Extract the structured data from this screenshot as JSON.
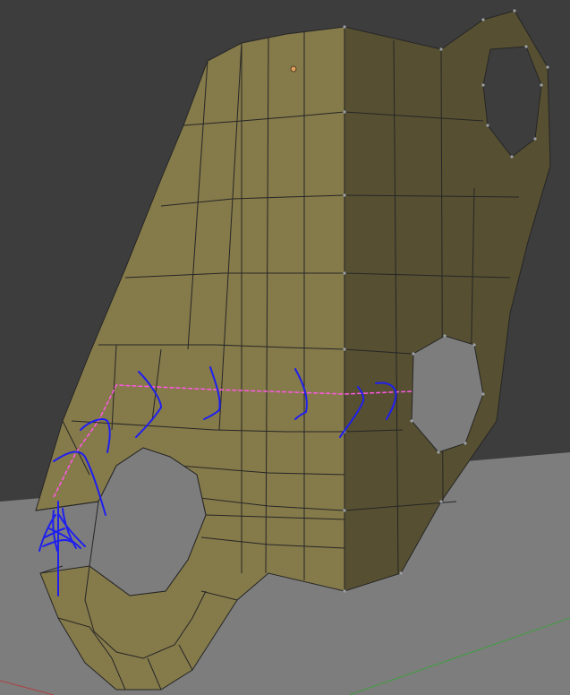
{
  "viewport": {
    "background_color": "#3d3d3d",
    "ground_color": "#7d7d7d",
    "mesh_face_color": "#857a4a",
    "mesh_face_shadow_color": "#564f31",
    "mesh_edge_color": "#262626",
    "vertex_color": "#9aa0a6",
    "selected_edge_loop_color": "#ff58e6",
    "annotation_stroke_color": "#1f1ff0",
    "origin_marker_color": "#e0a060",
    "axis_x_color": "#b04040",
    "axis_y_color": "#3f9f3f"
  },
  "objects": {
    "mesh_name": "",
    "holes_count": 3
  }
}
